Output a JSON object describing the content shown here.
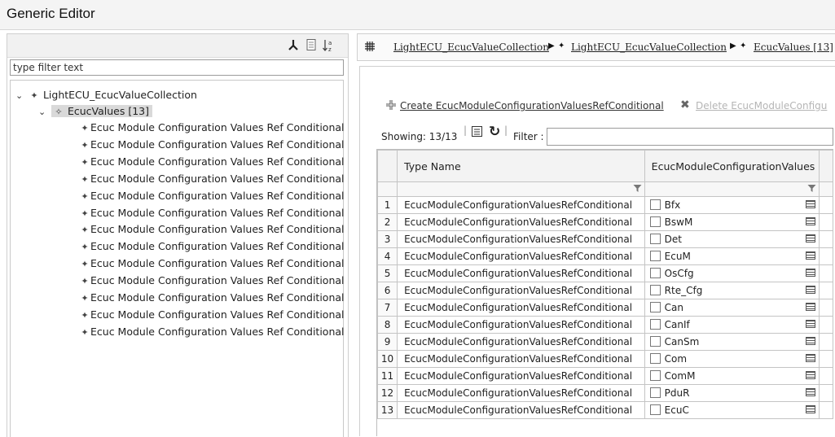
{
  "window": {
    "title": "Generic Editor"
  },
  "left": {
    "toolbar_icons": [
      "collapse-tree-icon",
      "document-icon",
      "sort-az-icon"
    ],
    "filter_placeholder": "type filter text",
    "tree_root": "LightECU_EcucValueCollection",
    "tree_child": "EcucValues [13]",
    "tree_leaves": [
      "Ecuc Module Configuration Values Ref Conditional",
      "Ecuc Module Configuration Values Ref Conditional",
      "Ecuc Module Configuration Values Ref Conditional",
      "Ecuc Module Configuration Values Ref Conditional",
      "Ecuc Module Configuration Values Ref Conditional",
      "Ecuc Module Configuration Values Ref Conditional",
      "Ecuc Module Configuration Values Ref Conditional",
      "Ecuc Module Configuration Values Ref Conditional",
      "Ecuc Module Configuration Values Ref Conditional",
      "Ecuc Module Configuration Values Ref Conditional",
      "Ecuc Module Configuration Values Ref Conditional",
      "Ecuc Module Configuration Values Ref Conditional",
      "Ecuc Module Configuration Values Ref Conditional"
    ]
  },
  "right": {
    "breadcrumb": [
      "LightECU_EcucValueCollection",
      "LightECU_EcucValueCollection",
      "EcucValues [13]"
    ],
    "create_label": "Create EcucModuleConfigurationValuesRefConditional",
    "delete_label": "Delete EcucModuleConfigu",
    "showing_label": "Showing: 13/13",
    "filter_label": "Filter :",
    "columns": [
      "Type Name",
      "EcucModuleConfigurationValues"
    ],
    "rows": [
      {
        "idx": "1",
        "type": "EcucModuleConfigurationValuesRefConditional",
        "value": "Bfx"
      },
      {
        "idx": "2",
        "type": "EcucModuleConfigurationValuesRefConditional",
        "value": "BswM"
      },
      {
        "idx": "3",
        "type": "EcucModuleConfigurationValuesRefConditional",
        "value": "Det"
      },
      {
        "idx": "4",
        "type": "EcucModuleConfigurationValuesRefConditional",
        "value": "EcuM"
      },
      {
        "idx": "5",
        "type": "EcucModuleConfigurationValuesRefConditional",
        "value": "OsCfg"
      },
      {
        "idx": "6",
        "type": "EcucModuleConfigurationValuesRefConditional",
        "value": "Rte_Cfg"
      },
      {
        "idx": "7",
        "type": "EcucModuleConfigurationValuesRefConditional",
        "value": "Can"
      },
      {
        "idx": "8",
        "type": "EcucModuleConfigurationValuesRefConditional",
        "value": "CanIf"
      },
      {
        "idx": "9",
        "type": "EcucModuleConfigurationValuesRefConditional",
        "value": "CanSm"
      },
      {
        "idx": "10",
        "type": "EcucModuleConfigurationValuesRefConditional",
        "value": "Com"
      },
      {
        "idx": "11",
        "type": "EcucModuleConfigurationValuesRefConditional",
        "value": "ComM"
      },
      {
        "idx": "12",
        "type": "EcucModuleConfigurationValuesRefConditional",
        "value": "PduR"
      },
      {
        "idx": "13",
        "type": "EcucModuleConfigurationValuesRefConditional",
        "value": "EcuC"
      }
    ]
  },
  "colors": {
    "selection": "#d9d9d9",
    "link_disabled": "#b5b5b5"
  }
}
